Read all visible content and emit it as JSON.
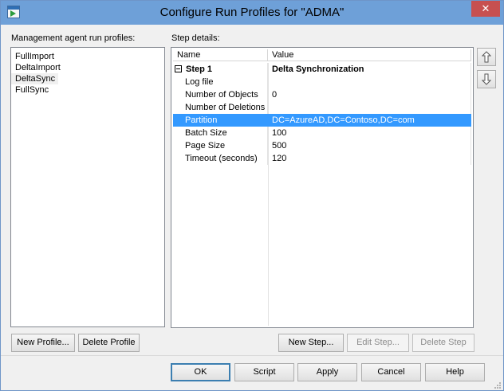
{
  "window": {
    "title": "Configure Run Profiles for \"ADMA\"",
    "close_glyph": "✕"
  },
  "profiles": {
    "label": "Management agent run profiles:",
    "items": [
      "FullImport",
      "DeltaImport",
      "DeltaSync",
      "FullSync"
    ],
    "selected": "DeltaSync"
  },
  "step_details": {
    "label": "Step details:",
    "columns": [
      "Name",
      "Value"
    ],
    "rows": [
      {
        "name": "Step 1",
        "value": "Delta Synchronization",
        "kind": "step"
      },
      {
        "name": "Log file",
        "value": ""
      },
      {
        "name": "Number of Objects",
        "value": "0"
      },
      {
        "name": "Number of Deletions",
        "value": ""
      },
      {
        "name": "Partition",
        "value": "DC=AzureAD,DC=Contoso,DC=com",
        "selected": true
      },
      {
        "name": "Batch Size",
        "value": "100"
      },
      {
        "name": "Page Size",
        "value": "500"
      },
      {
        "name": "Timeout (seconds)",
        "value": "120"
      }
    ]
  },
  "buttons": {
    "new_profile": "New Profile...",
    "delete_profile": "Delete Profile",
    "new_step": "New Step...",
    "edit_step": "Edit Step...",
    "delete_step": "Delete Step",
    "ok": "OK",
    "script": "Script",
    "apply": "Apply",
    "cancel": "Cancel",
    "help": "Help"
  },
  "icons": {
    "app": "run-profile-icon",
    "move_up": "arrow-up-icon",
    "move_down": "arrow-down-icon"
  },
  "colors": {
    "titlebar": "#6ea0d8",
    "selection": "#3399ff",
    "close": "#c75050"
  }
}
